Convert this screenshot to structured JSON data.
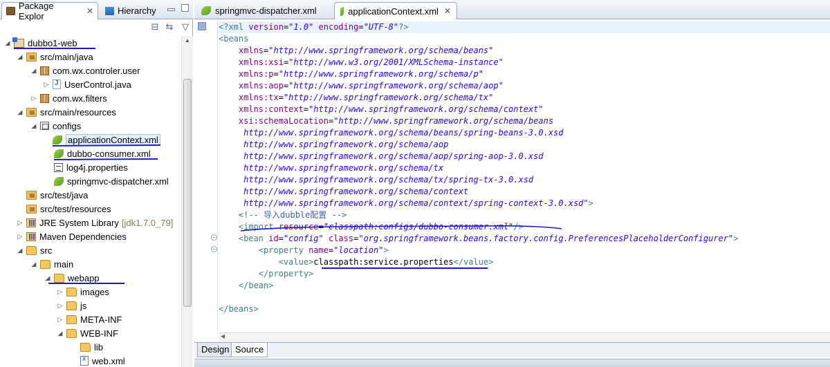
{
  "left_panel": {
    "tabs": [
      {
        "label": "Package Explor",
        "icon": "package-explorer-icon"
      },
      {
        "label": "Hierarchy",
        "icon": "hierarchy-icon"
      }
    ],
    "tree": [
      {
        "label": "dubbo1-web",
        "icon": "project-icon",
        "depth": 0,
        "expanded": true
      },
      {
        "label": "src/main/java",
        "icon": "source-folder-icon",
        "depth": 1,
        "expanded": true
      },
      {
        "label": "com.wx.controler.user",
        "icon": "package-icon",
        "depth": 2,
        "expanded": true
      },
      {
        "label": "UserControl.java",
        "icon": "java-file-icon",
        "depth": 3,
        "expanded": false
      },
      {
        "label": "com.wx.filters",
        "icon": "package-icon",
        "depth": 2,
        "expanded": false
      },
      {
        "label": "src/main/resources",
        "icon": "source-folder-icon",
        "depth": 1,
        "expanded": true
      },
      {
        "label": "configs",
        "icon": "configs-folder-icon",
        "depth": 2,
        "expanded": true
      },
      {
        "label": "applicationContext.xml",
        "icon": "spring-xml-icon",
        "depth": 3,
        "selected": true
      },
      {
        "label": "dubbo-consumer.xml",
        "icon": "spring-xml-icon",
        "depth": 3
      },
      {
        "label": "log4j.properties",
        "icon": "properties-file-icon",
        "depth": 3
      },
      {
        "label": "springmvc-dispatcher.xml",
        "icon": "spring-xml-icon",
        "depth": 3
      },
      {
        "label": "src/test/java",
        "icon": "source-folder-icon",
        "depth": 1
      },
      {
        "label": "src/test/resources",
        "icon": "source-folder-icon",
        "depth": 1
      },
      {
        "label": "JRE System Library",
        "extra": "[jdk1.7.0_79]",
        "icon": "library-icon",
        "depth": 1,
        "expanded": false
      },
      {
        "label": "Maven Dependencies",
        "icon": "library-icon",
        "depth": 1,
        "expanded": false
      },
      {
        "label": "src",
        "icon": "folder-icon",
        "depth": 1,
        "expanded": true
      },
      {
        "label": "main",
        "icon": "folder-icon",
        "depth": 2,
        "expanded": true
      },
      {
        "label": "webapp",
        "icon": "folder-icon",
        "depth": 3,
        "expanded": true
      },
      {
        "label": "images",
        "icon": "folder-icon",
        "depth": 4,
        "expanded": false
      },
      {
        "label": "js",
        "icon": "folder-icon",
        "depth": 4,
        "expanded": false
      },
      {
        "label": "META-INF",
        "icon": "folder-icon",
        "depth": 4,
        "expanded": false
      },
      {
        "label": "WEB-INF",
        "icon": "folder-icon",
        "depth": 4,
        "expanded": true
      },
      {
        "label": "lib",
        "icon": "folder-icon",
        "depth": 5
      },
      {
        "label": "web.xml",
        "icon": "xml-file-icon",
        "depth": 5
      }
    ]
  },
  "editor": {
    "tabs": [
      {
        "label": "springmvc-dispatcher.xml",
        "active": false
      },
      {
        "label": "applicationContext.xml",
        "active": true
      }
    ],
    "code_lines": [
      "<?xml version=\"1.0\" encoding=\"UTF-8\"?>",
      "<beans",
      "    xmlns=\"http://www.springframework.org/schema/beans\"",
      "    xmlns:xsi=\"http://www.w3.org/2001/XMLSchema-instance\"",
      "    xmlns:p=\"http://www.springframework.org/schema/p\"",
      "    xmlns:aop=\"http://www.springframework.org/schema/aop\"",
      "    xmlns:tx=\"http://www.springframework.org/schema/tx\"",
      "    xmlns:context=\"http://www.springframework.org/schema/context\"",
      "    xsi:schemaLocation=\"http://www.springframework.org/schema/beans",
      "     http://www.springframework.org/schema/beans/spring-beans-3.0.xsd",
      "     http://www.springframework.org/schema/aop",
      "     http://www.springframework.org/schema/aop/spring-aop-3.0.xsd",
      "     http://www.springframework.org/schema/tx",
      "     http://www.springframework.org/schema/tx/spring-tx-3.0.xsd",
      "     http://www.springframework.org/schema/context",
      "     http://www.springframework.org/schema/context/spring-context-3.0.xsd\">",
      "    <!-- 导入dubble配置 -->",
      "    <import resource=\"classpath:configs/dubbo-consumer.xml\"/>",
      "    <bean id=\"config\" class=\"org.springframework.beans.factory.config.PreferencesPlaceholderConfigurer\">",
      "        <property name=\"location\">",
      "            <value>classpath:service.properties</value>",
      "        </property>",
      "    </bean>",
      "",
      "</beans>"
    ],
    "bottom_tabs": [
      {
        "label": "Design",
        "active": false
      },
      {
        "label": "Source",
        "active": true
      }
    ]
  },
  "colors": {
    "xml_tag": "#3f7f7f",
    "xml_attr": "#7f007f",
    "xml_value": "#2a00ff",
    "xml_comment": "#3f5fbf",
    "annotation_underline": "#1a1acc",
    "selection_bg": "#e4eef9"
  }
}
